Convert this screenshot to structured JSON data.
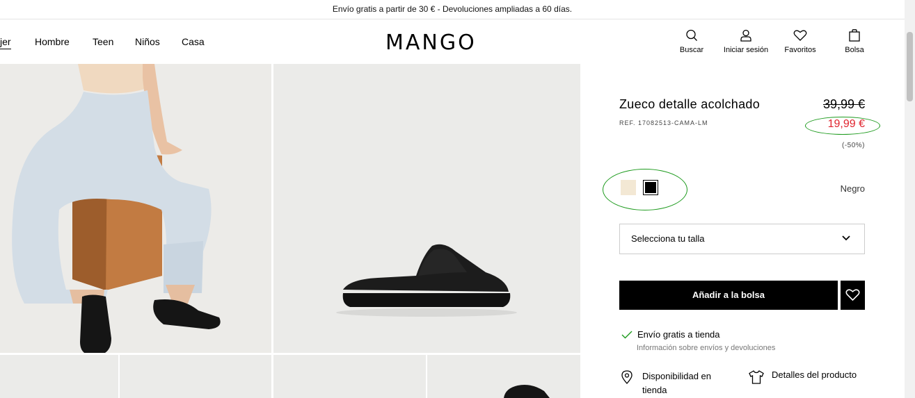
{
  "promo": {
    "text": "Envío gratis a partir de 30 € - Devoluciones ampliadas a 60 días."
  },
  "nav": {
    "items": [
      {
        "label": "jer"
      },
      {
        "label": "Hombre"
      },
      {
        "label": "Teen"
      },
      {
        "label": "Niños"
      },
      {
        "label": "Casa"
      }
    ]
  },
  "logo": "MANGO",
  "utility": {
    "search": "Buscar",
    "login": "Iniciar sesión",
    "favorites": "Favoritos",
    "bag": "Bolsa"
  },
  "product": {
    "title": "Zueco detalle acolchado",
    "ref": "REF. 17082513-CAMA-LM",
    "old_price": "39,99 €",
    "new_price": "19,99 €",
    "discount": "(-50%)",
    "color_name": "Negro",
    "colors": [
      {
        "name": "cream",
        "hex": "#f3e8d4"
      },
      {
        "name": "black",
        "hex": "#000000",
        "selected": true
      }
    ],
    "size_placeholder": "Selecciona tu talla",
    "add_to_bag": "Añadir a la bolsa",
    "shipping": "Envío gratis a tienda",
    "shipping_info": "Información sobre envíos y devoluciones",
    "availability": "Disponibilidad en tienda",
    "details": "Detalles del producto"
  },
  "colors": {
    "sale_red": "#e0242e",
    "annotation_green": "#1c9a1c",
    "check_green": "#1c9a1c"
  }
}
